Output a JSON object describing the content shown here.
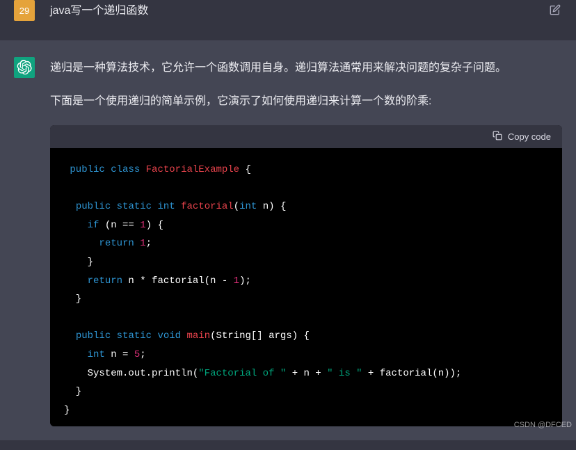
{
  "user": {
    "avatar_text": "29",
    "prompt": "java写一个递归函数"
  },
  "assistant": {
    "paragraph1": "递归是一种算法技术，它允许一个函数调用自身。递归算法通常用来解决问题的复杂子问题。",
    "paragraph2": "下面是一个使用递归的简单示例，它演示了如何使用递归来计算一个数的阶乘:",
    "copy_label": "Copy code"
  },
  "chart_data": {
    "type": "table",
    "language": "java",
    "code_plain": "public class FactorialExample {\n\n  public static int factorial(int n) {\n    if (n == 1) {\n      return 1;\n    }\n    return n * factorial(n - 1);\n  }\n\n  public static void main(String[] args) {\n    int n = 5;\n    System.out.println(\"Factorial of \" + n + \" is \" + factorial(n));\n  }\n}",
    "tokens": [
      [
        [
          "",
          " "
        ],
        [
          "kw",
          "public"
        ],
        [
          "",
          " "
        ],
        [
          "kw",
          "class"
        ],
        [
          "",
          " "
        ],
        [
          "cls",
          "FactorialExample"
        ],
        [
          "",
          " {"
        ]
      ],
      [
        [
          "",
          ""
        ]
      ],
      [
        [
          "",
          "  "
        ],
        [
          "kw",
          "public"
        ],
        [
          "",
          " "
        ],
        [
          "kw",
          "static"
        ],
        [
          "",
          " "
        ],
        [
          "type",
          "int"
        ],
        [
          "",
          " "
        ],
        [
          "fn",
          "factorial"
        ],
        [
          "punc",
          "("
        ],
        [
          "type",
          "int"
        ],
        [
          "",
          " n"
        ],
        [
          "punc",
          ")"
        ],
        [
          "",
          " {"
        ]
      ],
      [
        [
          "",
          "    "
        ],
        [
          "kw",
          "if"
        ],
        [
          "",
          " (n == "
        ],
        [
          "num",
          "1"
        ],
        [
          "punc",
          ")"
        ],
        [
          "",
          " {"
        ]
      ],
      [
        [
          "",
          "      "
        ],
        [
          "kw",
          "return"
        ],
        [
          "",
          " "
        ],
        [
          "num",
          "1"
        ],
        [
          "punc",
          ";"
        ]
      ],
      [
        [
          "",
          "    }"
        ]
      ],
      [
        [
          "",
          "    "
        ],
        [
          "kw",
          "return"
        ],
        [
          "",
          " n * factorial(n - "
        ],
        [
          "num",
          "1"
        ],
        [
          "punc",
          ")"
        ],
        [
          "punc",
          ";"
        ]
      ],
      [
        [
          "",
          "  }"
        ]
      ],
      [
        [
          "",
          ""
        ]
      ],
      [
        [
          "",
          "  "
        ],
        [
          "kw",
          "public"
        ],
        [
          "",
          " "
        ],
        [
          "kw",
          "static"
        ],
        [
          "",
          " "
        ],
        [
          "type",
          "void"
        ],
        [
          "",
          " "
        ],
        [
          "fn",
          "main"
        ],
        [
          "punc",
          "("
        ],
        [
          "",
          "String[] args"
        ],
        [
          "punc",
          ")"
        ],
        [
          "",
          " {"
        ]
      ],
      [
        [
          "",
          "    "
        ],
        [
          "type",
          "int"
        ],
        [
          "",
          " n = "
        ],
        [
          "num",
          "5"
        ],
        [
          "punc",
          ";"
        ]
      ],
      [
        [
          "",
          "    System."
        ],
        [
          "",
          "out"
        ],
        [
          "",
          ".println("
        ],
        [
          "str",
          "\"Factorial of \""
        ],
        [
          "",
          " + n + "
        ],
        [
          "str",
          "\" is \""
        ],
        [
          "",
          " + factorial(n));"
        ]
      ],
      [
        [
          "",
          "  }"
        ]
      ],
      [
        [
          "",
          "}"
        ]
      ]
    ]
  },
  "watermark": "CSDN @DFCED"
}
